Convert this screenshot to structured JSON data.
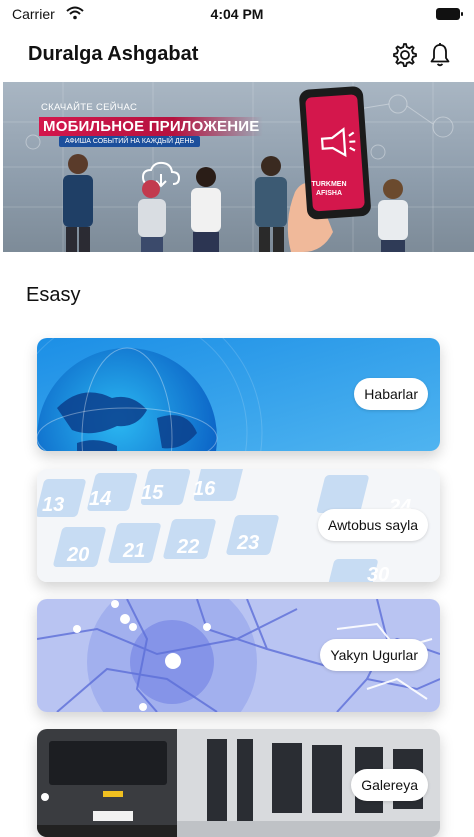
{
  "status_bar": {
    "carrier": "Carrier",
    "time": "4:04 PM"
  },
  "header": {
    "title": "Duralga Ashgabat",
    "settings_icon": "gear-icon",
    "notifications_icon": "bell-icon"
  },
  "banner": {
    "subtitle": "СКАЧАЙТЕ СЕЙЧАС",
    "title": "МОБИЛЬНОЕ ПРИЛОЖЕНИЕ",
    "tagline": "АФИША СОБЫТИЙ НА КАЖДЫЙ ДЕНЬ",
    "brand": "TURKMEN AFISHA",
    "accent_color": "#d4174c"
  },
  "section": {
    "title": "Esasy"
  },
  "cards": [
    {
      "label": "Habarlar",
      "theme": "globe"
    },
    {
      "label": "Awtobus sayla",
      "theme": "calendar",
      "numbers": [
        "13",
        "14",
        "15",
        "16",
        "20",
        "21",
        "22",
        "23",
        "24",
        "30"
      ]
    },
    {
      "label": "Yakyn Ugurlar",
      "theme": "map"
    },
    {
      "label": "Galereya",
      "theme": "bus"
    }
  ]
}
